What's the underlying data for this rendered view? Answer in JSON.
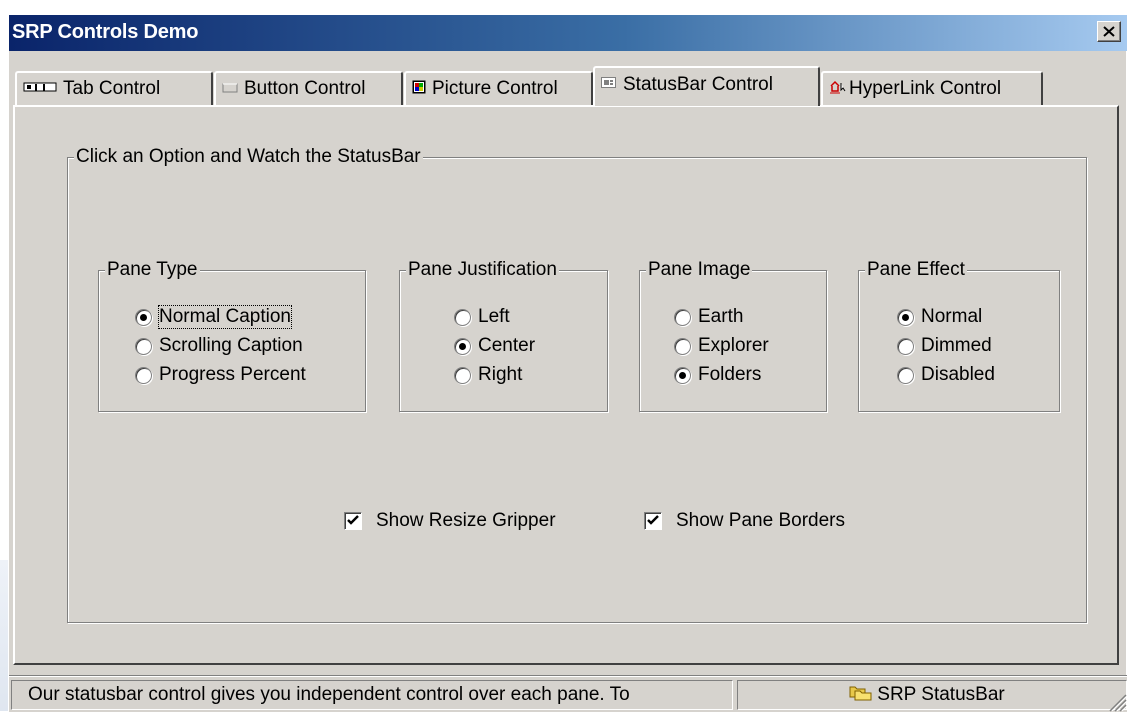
{
  "window": {
    "title": "SRP Controls Demo",
    "close_glyph": "✕"
  },
  "tabs": [
    {
      "label": "Tab Control",
      "icon": "tab-icon",
      "selected": false
    },
    {
      "label": "Button Control",
      "icon": "button-icon",
      "selected": false
    },
    {
      "label": "Picture Control",
      "icon": "picture-icon",
      "selected": false
    },
    {
      "label": "StatusBar Control",
      "icon": "statusbar-icon",
      "selected": true
    },
    {
      "label": "HyperLink Control",
      "icon": "hyperlink-icon",
      "selected": false
    }
  ],
  "main_group": {
    "label": "Click an Option and Watch the StatusBar"
  },
  "pane_type": {
    "label": "Pane Type",
    "options": [
      "Normal Caption",
      "Scrolling Caption",
      "Progress Percent"
    ],
    "selected": "Normal Caption"
  },
  "pane_justification": {
    "label": "Pane Justification",
    "options": [
      "Left",
      "Center",
      "Right"
    ],
    "selected": "Center"
  },
  "pane_image": {
    "label": "Pane Image",
    "options": [
      "Earth",
      "Explorer",
      "Folders"
    ],
    "selected": "Folders"
  },
  "pane_effect": {
    "label": "Pane Effect",
    "options": [
      "Normal",
      "Dimmed",
      "Disabled"
    ],
    "selected": "Normal"
  },
  "checkboxes": {
    "resize_gripper": {
      "label": "Show Resize Gripper",
      "checked": true
    },
    "pane_borders": {
      "label": "Show Pane Borders",
      "checked": true
    }
  },
  "statusbar": {
    "pane1_text": "Our statusbar control gives you independent control over each pane. To",
    "pane2_text": "SRP StatusBar",
    "pane2_icon": "folders-icon"
  },
  "colors": {
    "face": "#d6d3ce",
    "title_start": "#0a246a",
    "title_end": "#a6caf0"
  }
}
